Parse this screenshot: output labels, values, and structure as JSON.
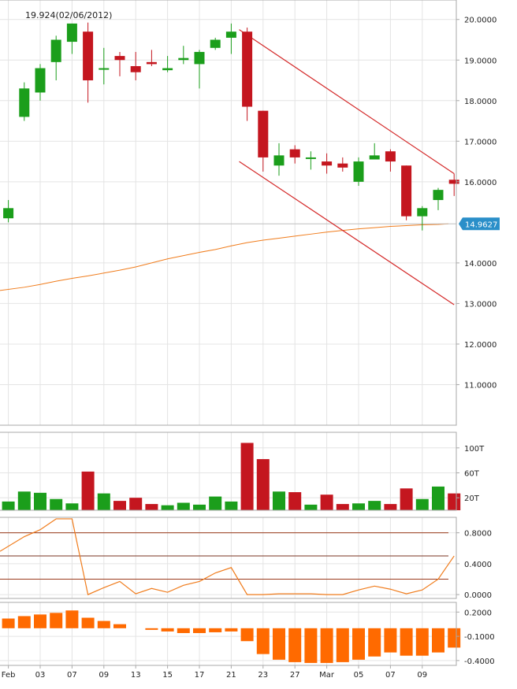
{
  "colors": {
    "up": "#1b9e1b",
    "down": "#c4161f",
    "ma_line": "#f07c1c",
    "trend_line": "#d42a2a",
    "grid": "#e4e4e4",
    "frame": "#a9a9a9",
    "text": "#222222",
    "price_tag_bg": "#2a8fc9",
    "price_tag_text": "#ffffff",
    "volume_up": "#1b9e1b",
    "volume_down": "#c4161f",
    "stoch_line": "#f07c1c",
    "stoch_level": "#9a3b1d",
    "histogram": "#ff6a00"
  },
  "chart_data": {
    "type": "candlestick",
    "tooltip": "19.924(02/06/2012)",
    "price_tag": "14.9627",
    "price_tag_value": 14.9627,
    "x_ticks": [
      "Feb",
      "03",
      "07",
      "09",
      "13",
      "15",
      "17",
      "21",
      "23",
      "27",
      "Mar",
      "05",
      "07",
      "09"
    ],
    "x_tick_index": [
      0.5,
      2.5,
      4.5,
      6.5,
      8.5,
      10.5,
      12.5,
      14.5,
      16.5,
      18.5,
      20.5,
      22.5,
      24.5,
      26.5
    ],
    "price_axis": {
      "ticks": [
        "20.0000",
        "19.0000",
        "18.0000",
        "17.0000",
        "16.0000",
        "14.0000",
        "13.0000",
        "12.0000",
        "11.0000"
      ],
      "tick_values": [
        20,
        19,
        18,
        17,
        16,
        14,
        13,
        12,
        11
      ],
      "range": [
        10.0,
        20.48
      ]
    },
    "candles": [
      {
        "o": 15.1,
        "h": 15.55,
        "l": 15.0,
        "c": 15.35
      },
      {
        "o": 17.6,
        "h": 18.45,
        "l": 17.5,
        "c": 18.3
      },
      {
        "o": 18.2,
        "h": 18.9,
        "l": 18.0,
        "c": 18.8
      },
      {
        "o": 18.95,
        "h": 19.6,
        "l": 18.5,
        "c": 19.5
      },
      {
        "o": 19.45,
        "h": 19.9,
        "l": 19.15,
        "c": 19.9
      },
      {
        "o": 19.7,
        "h": 19.924,
        "l": 17.95,
        "c": 18.5
      },
      {
        "o": 18.8,
        "h": 19.3,
        "l": 18.4,
        "c": 18.8
      },
      {
        "o": 19.1,
        "h": 19.2,
        "l": 18.6,
        "c": 19.0
      },
      {
        "o": 18.85,
        "h": 19.2,
        "l": 18.5,
        "c": 18.7
      },
      {
        "o": 18.95,
        "h": 19.25,
        "l": 18.85,
        "c": 18.9
      },
      {
        "o": 18.75,
        "h": 19.1,
        "l": 18.7,
        "c": 18.8
      },
      {
        "o": 19.0,
        "h": 19.35,
        "l": 18.9,
        "c": 19.05
      },
      {
        "o": 18.9,
        "h": 19.25,
        "l": 18.3,
        "c": 19.2
      },
      {
        "o": 19.3,
        "h": 19.55,
        "l": 19.25,
        "c": 19.5
      },
      {
        "o": 19.55,
        "h": 19.9,
        "l": 19.15,
        "c": 19.7
      },
      {
        "o": 19.7,
        "h": 19.8,
        "l": 17.5,
        "c": 17.85
      },
      {
        "o": 17.75,
        "h": 17.75,
        "l": 16.25,
        "c": 16.6
      },
      {
        "o": 16.4,
        "h": 16.95,
        "l": 16.15,
        "c": 16.65
      },
      {
        "o": 16.8,
        "h": 16.9,
        "l": 16.45,
        "c": 16.6
      },
      {
        "o": 16.6,
        "h": 16.75,
        "l": 16.3,
        "c": 16.6
      },
      {
        "o": 16.5,
        "h": 16.7,
        "l": 16.2,
        "c": 16.4
      },
      {
        "o": 16.45,
        "h": 16.6,
        "l": 16.25,
        "c": 16.35
      },
      {
        "o": 16.0,
        "h": 16.6,
        "l": 15.9,
        "c": 16.5
      },
      {
        "o": 16.55,
        "h": 16.95,
        "l": 16.55,
        "c": 16.65
      },
      {
        "o": 16.75,
        "h": 16.8,
        "l": 16.25,
        "c": 16.5
      },
      {
        "o": 16.4,
        "h": 16.4,
        "l": 15.05,
        "c": 15.15
      },
      {
        "o": 15.15,
        "h": 15.4,
        "l": 14.8,
        "c": 15.35
      },
      {
        "o": 15.55,
        "h": 15.85,
        "l": 15.3,
        "c": 15.8
      },
      {
        "o": 16.05,
        "h": 16.2,
        "l": 15.65,
        "c": 15.95
      }
    ],
    "moving_average": [
      13.32,
      13.4,
      13.47,
      13.55,
      13.62,
      13.68,
      13.75,
      13.82,
      13.9,
      14.0,
      14.1,
      14.18,
      14.26,
      14.33,
      14.42,
      14.5,
      14.56,
      14.61,
      14.66,
      14.71,
      14.76,
      14.8,
      14.84,
      14.87,
      14.9,
      14.92,
      14.94,
      14.95,
      14.9627
    ],
    "trend_lines": [
      {
        "x1": 15.0,
        "y1": 19.75,
        "x2": 28.5,
        "y2": 16.2
      },
      {
        "x1": 15.0,
        "y1": 16.5,
        "x2": 28.5,
        "y2": 12.97
      }
    ],
    "volume": {
      "ticks": [
        "100T",
        "60T",
        "20T"
      ],
      "tick_values": [
        100,
        60,
        20
      ],
      "range": [
        0,
        125
      ],
      "values": [
        14,
        30,
        28,
        18,
        11,
        62,
        27,
        15,
        20,
        10,
        8,
        12,
        9,
        22,
        14,
        108,
        82,
        30,
        29,
        9,
        25,
        10,
        11,
        15,
        10,
        35,
        18,
        38,
        27
      ]
    },
    "oscillator": {
      "ticks": [
        "0.8000",
        "0.4000",
        "0.0000"
      ],
      "tick_values": [
        0.8,
        0.4,
        0.0
      ],
      "range": [
        -0.05,
        1.0
      ],
      "levels": [
        0.8,
        0.5,
        0.2
      ],
      "values": [
        0.56,
        0.75,
        0.84,
        0.98,
        0.98,
        0.0,
        0.09,
        0.17,
        0.01,
        0.08,
        0.03,
        0.12,
        0.17,
        0.28,
        0.35,
        0.0,
        0.0,
        0.01,
        0.01,
        0.01,
        0.0,
        0.0,
        0.06,
        0.11,
        0.07,
        0.01,
        0.06,
        0.2,
        0.5
      ]
    },
    "histogram": {
      "ticks": [
        "0.2000",
        "-0.1000",
        "-0.4000"
      ],
      "tick_values": [
        0.2,
        -0.1,
        -0.4
      ],
      "range": [
        -0.46,
        0.32
      ],
      "values": [
        0.12,
        0.15,
        0.17,
        0.19,
        0.22,
        0.13,
        0.09,
        0.05,
        0.0,
        -0.02,
        -0.04,
        -0.06,
        -0.06,
        -0.05,
        -0.04,
        -0.16,
        -0.32,
        -0.39,
        -0.42,
        -0.43,
        -0.43,
        -0.42,
        -0.39,
        -0.35,
        -0.3,
        -0.34,
        -0.34,
        -0.3,
        -0.24
      ]
    }
  }
}
